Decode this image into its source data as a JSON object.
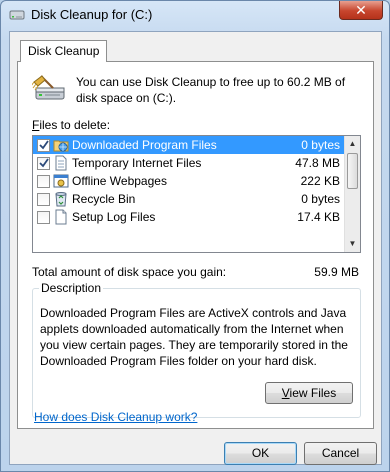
{
  "window": {
    "title": "Disk Cleanup for  (C:)",
    "close_glyph": "✕"
  },
  "tab": {
    "label": "Disk Cleanup"
  },
  "header": {
    "icon": "disk-cleanup-icon",
    "text": "You can use Disk Cleanup to free up to 60.2 MB of disk space on  (C:)."
  },
  "files": {
    "label_accel": "F",
    "label_rest": "iles to delete:",
    "items": [
      {
        "name": "Downloaded Program Files",
        "size": "0 bytes",
        "checked": true,
        "selected": true,
        "icon": "folder-globe-icon"
      },
      {
        "name": "Temporary Internet Files",
        "size": "47.8 MB",
        "checked": true,
        "selected": false,
        "icon": "document-icon"
      },
      {
        "name": "Offline Webpages",
        "size": "222 KB",
        "checked": false,
        "selected": false,
        "icon": "offline-webpage-icon"
      },
      {
        "name": "Recycle Bin",
        "size": "0 bytes",
        "checked": false,
        "selected": false,
        "icon": "recycle-bin-icon"
      },
      {
        "name": "Setup Log Files",
        "size": "17.4 KB",
        "checked": false,
        "selected": false,
        "icon": "log-file-icon"
      }
    ]
  },
  "total": {
    "label": "Total amount of disk space you gain:",
    "value": "59.9 MB"
  },
  "description": {
    "title": "Description",
    "text": "Downloaded Program Files are ActiveX controls and Java applets downloaded automatically from the Internet when you view certain pages. They are temporarily stored in the Downloaded Program Files folder on your hard disk.",
    "view_files_accel": "V",
    "view_files_rest": "iew Files"
  },
  "help_link": "How does Disk Cleanup work?",
  "buttons": {
    "ok": "OK",
    "cancel": "Cancel"
  },
  "colors": {
    "selection": "#3399ff",
    "link": "#0066cc",
    "close": "#c7452d"
  }
}
